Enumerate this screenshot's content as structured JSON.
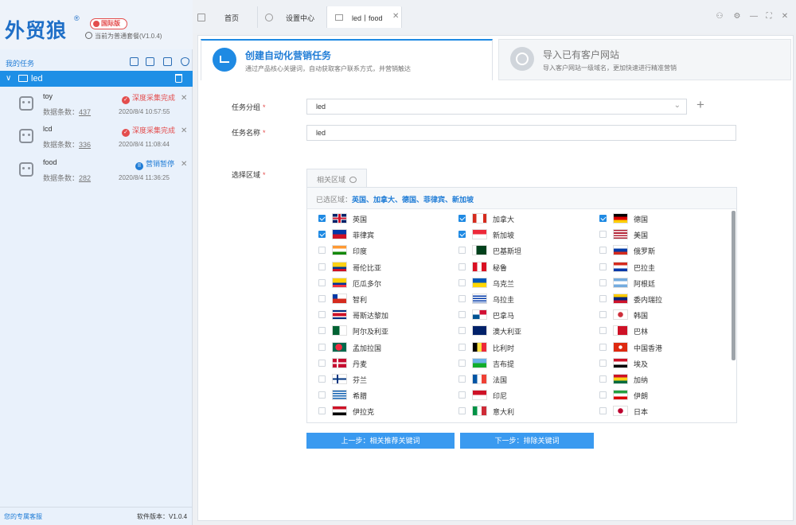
{
  "app": {
    "logo": "外贸狼",
    "logo_reg": "®",
    "intl_badge": "国际版",
    "plan_text": "当前为普通套餐(V1.0.4)"
  },
  "sidebar": {
    "my_tasks_label": "我的任务",
    "toolbar_icons": [
      "calendar-icon",
      "export-icon",
      "import-icon",
      "shield-icon"
    ],
    "group": {
      "name": "led",
      "chevron": "∨"
    },
    "tasks": [
      {
        "name": "toy",
        "status": "深度采集完成",
        "status_type": "done",
        "count_label": "数据条数：",
        "count": "437",
        "time": "2020/8/4 10:57:55"
      },
      {
        "name": "lcd",
        "status": "深度采集完成",
        "status_type": "done",
        "count_label": "数据条数：",
        "count": "336",
        "time": "2020/8/4 11:08:44"
      },
      {
        "name": "food",
        "status": "营销暂停",
        "status_type": "pause",
        "count_label": "数据条数：",
        "count": "282",
        "time": "2020/8/4 11:36:25"
      }
    ],
    "footer_left": "您的专属客服",
    "footer_right": "软件版本：V1.0.4"
  },
  "tabs": [
    {
      "label": "首页",
      "icon": "home-icon"
    },
    {
      "label": "设置中心",
      "icon": "gear-icon"
    },
    {
      "label": "led丨food",
      "icon": "folder-icon",
      "active": true
    }
  ],
  "window_controls": [
    "user-icon",
    "gear-icon",
    "minimize-icon",
    "maximize-icon",
    "close-icon"
  ],
  "cards": {
    "create": {
      "title": "创建自动化营销任务",
      "subtitle": "通过产品核心关键词，自动获取客户联系方式，并营销触达"
    },
    "import": {
      "title": "导入已有客户网站",
      "subtitle": "导入客户网站一级域名，更加快速进行精准营销"
    }
  },
  "form": {
    "group_label": "任务分组",
    "group_value": "led",
    "name_label": "任务名称",
    "name_value": "led",
    "region_label": "选择区域",
    "required_mark": "*",
    "region_tab": "相关区域",
    "selected_prefix": "已选区域：",
    "selected_value": "英国、加拿大、德国、菲律宾、新加坡"
  },
  "countries": [
    {
      "name": "英国",
      "checked": true,
      "flag": "uk"
    },
    {
      "name": "加拿大",
      "checked": true,
      "flag": "ca"
    },
    {
      "name": "德国",
      "checked": true,
      "flag": "de"
    },
    {
      "name": "菲律宾",
      "checked": true,
      "flag": "ph"
    },
    {
      "name": "新加坡",
      "checked": true,
      "flag": "sg"
    },
    {
      "name": "美国",
      "checked": false,
      "flag": "us"
    },
    {
      "name": "印度",
      "checked": false,
      "flag": "in"
    },
    {
      "name": "巴基斯坦",
      "checked": false,
      "flag": "pk"
    },
    {
      "name": "俄罗斯",
      "checked": false,
      "flag": "ru"
    },
    {
      "name": "哥伦比亚",
      "checked": false,
      "flag": "co"
    },
    {
      "name": "秘鲁",
      "checked": false,
      "flag": "pe"
    },
    {
      "name": "巴拉圭",
      "checked": false,
      "flag": "py"
    },
    {
      "name": "厄瓜多尔",
      "checked": false,
      "flag": "ec"
    },
    {
      "name": "乌克兰",
      "checked": false,
      "flag": "ua"
    },
    {
      "name": "阿根廷",
      "checked": false,
      "flag": "ar"
    },
    {
      "name": "智利",
      "checked": false,
      "flag": "cl"
    },
    {
      "name": "乌拉圭",
      "checked": false,
      "flag": "uy"
    },
    {
      "name": "委内瑞拉",
      "checked": false,
      "flag": "ve"
    },
    {
      "name": "哥斯达黎加",
      "checked": false,
      "flag": "cr"
    },
    {
      "name": "巴拿马",
      "checked": false,
      "flag": "pa"
    },
    {
      "name": "韩国",
      "checked": false,
      "flag": "kr"
    },
    {
      "name": "阿尔及利亚",
      "checked": false,
      "flag": "dz"
    },
    {
      "name": "澳大利亚",
      "checked": false,
      "flag": "au"
    },
    {
      "name": "巴林",
      "checked": false,
      "flag": "bh"
    },
    {
      "name": "孟加拉国",
      "checked": false,
      "flag": "bd"
    },
    {
      "name": "比利时",
      "checked": false,
      "flag": "be"
    },
    {
      "name": "中国香港",
      "checked": false,
      "flag": "hk"
    },
    {
      "name": "丹麦",
      "checked": false,
      "flag": "dk"
    },
    {
      "name": "吉布提",
      "checked": false,
      "flag": "dj"
    },
    {
      "name": "埃及",
      "checked": false,
      "flag": "eg"
    },
    {
      "name": "芬兰",
      "checked": false,
      "flag": "fi"
    },
    {
      "name": "法国",
      "checked": false,
      "flag": "fr"
    },
    {
      "name": "加纳",
      "checked": false,
      "flag": "gh"
    },
    {
      "name": "希腊",
      "checked": false,
      "flag": "gr"
    },
    {
      "name": "印尼",
      "checked": false,
      "flag": "id"
    },
    {
      "name": "伊朗",
      "checked": false,
      "flag": "ir"
    },
    {
      "name": "伊拉克",
      "checked": false,
      "flag": "iq"
    },
    {
      "name": "意大利",
      "checked": false,
      "flag": "it"
    },
    {
      "name": "日本",
      "checked": false,
      "flag": "jp"
    }
  ],
  "buttons": {
    "prev": "上一步：相关推荐关键词",
    "next": "下一步：排除关键词"
  },
  "colors": {
    "accent": "#1f8ae3",
    "sidebar_selected": "#1e8fe6",
    "status_done": "#e34d4d",
    "status_pause": "#1f7cd6"
  }
}
